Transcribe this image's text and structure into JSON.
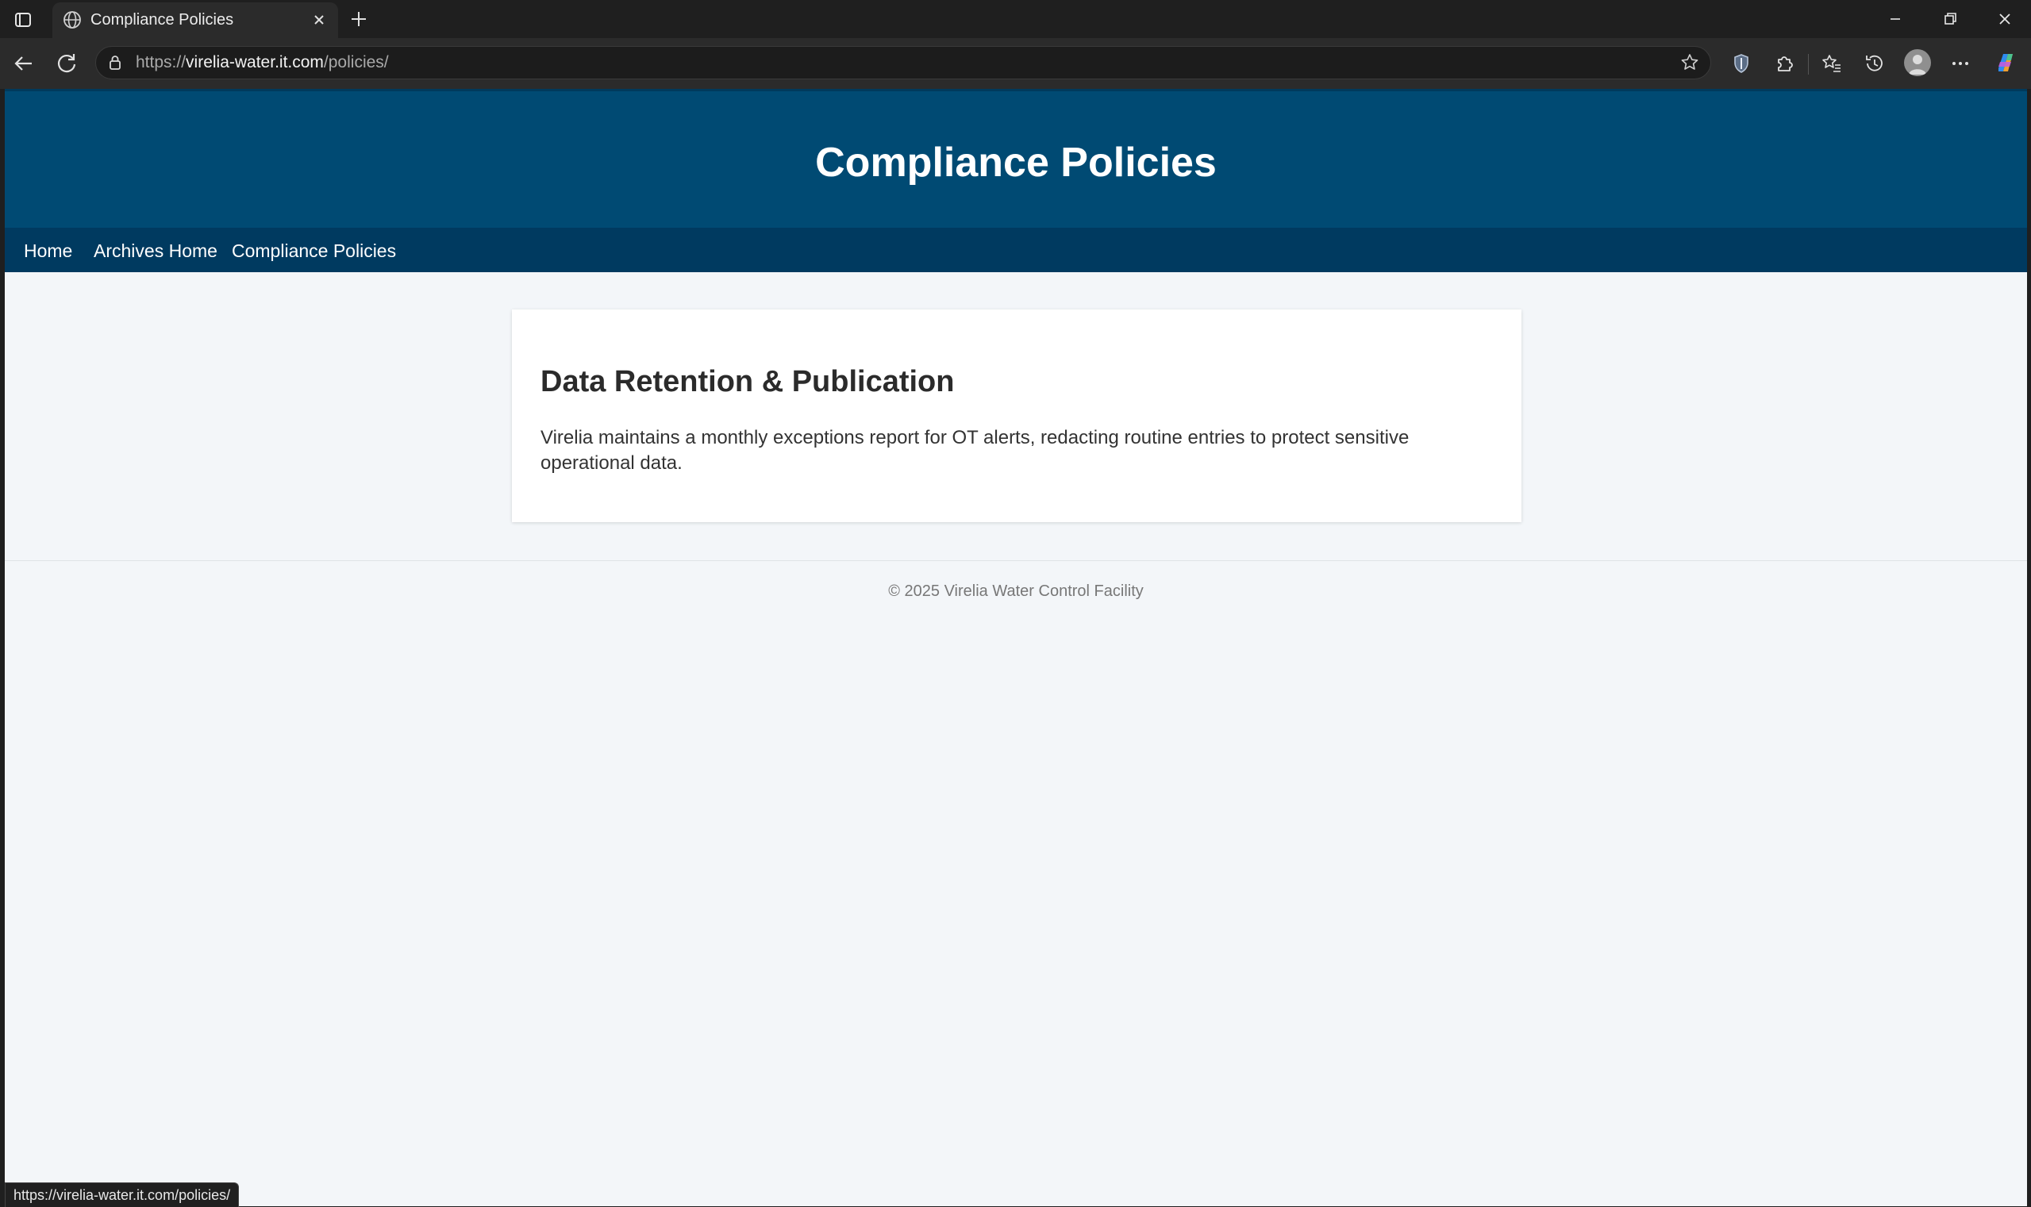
{
  "browser": {
    "tab_title": "Compliance Policies",
    "url_scheme": "https://",
    "url_host": "virelia-water.it.com",
    "url_path": "/policies/",
    "status_url": "https://virelia-water.it.com/policies/"
  },
  "icons": {
    "tab_actions": "tab-actions-icon",
    "favicon": "globe-icon",
    "close": "close-icon",
    "new_tab": "plus-icon",
    "back": "back-arrow-icon",
    "reload": "reload-icon",
    "lock": "lock-icon",
    "favorite": "star-icon",
    "shield": "shield-icon",
    "extensions": "puzzle-icon",
    "favorites": "favorites-icon",
    "history": "history-icon",
    "profile": "avatar-icon",
    "more": "more-icon",
    "copilot": "copilot-icon"
  },
  "site": {
    "title": "Compliance Policies",
    "nav": [
      "Home",
      "Archives Home",
      "Compliance Policies"
    ]
  },
  "card": {
    "heading": "Data Retention & Publication",
    "body": "Virelia maintains a monthly exceptions report for OT alerts, redacting routine entries to protect sensitive operational data."
  },
  "footer": {
    "text": "© 2025 Virelia Water Control Facility"
  },
  "colors": {
    "header": "#004a73",
    "nav": "#003a60",
    "page_bg": "#f3f6f9"
  }
}
